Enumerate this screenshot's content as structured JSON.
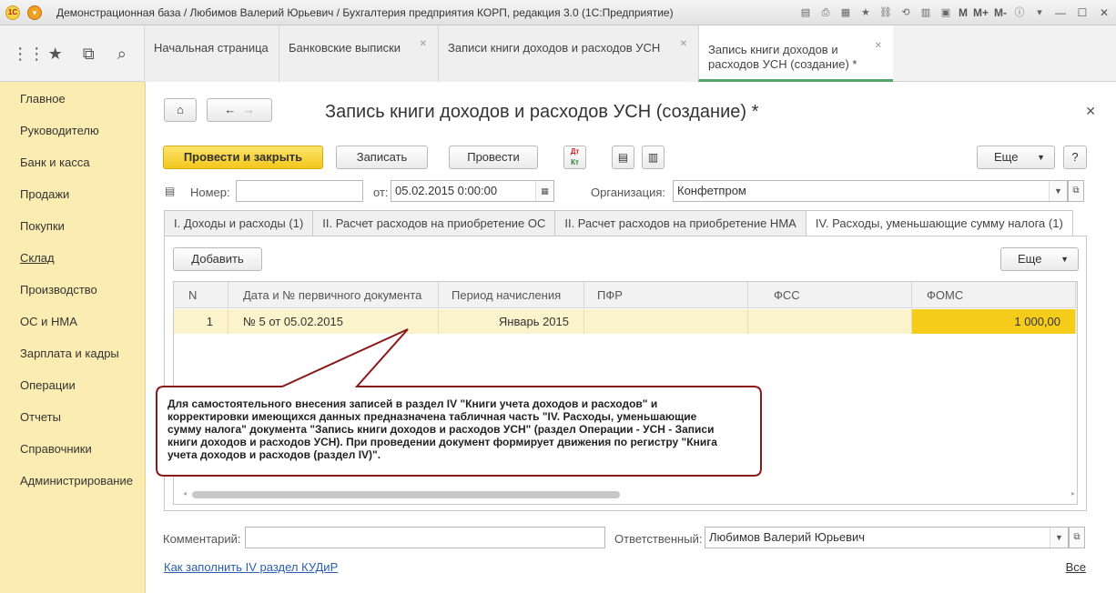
{
  "window": {
    "title": "Демонстрационная база / Любимов Валерий Юрьевич / Бухгалтерия предприятия КОРП, редакция 3.0  (1С:Предприятие)",
    "tools": [
      "M",
      "M+",
      "M-"
    ]
  },
  "tabs": [
    {
      "label": "Начальная страница"
    },
    {
      "label": "Банковские выписки"
    },
    {
      "label": "Записи книги доходов и расходов УСН"
    },
    {
      "label_line1": "Запись книги доходов и",
      "label_line2": "расходов УСН (создание) *"
    }
  ],
  "sidebar": {
    "items": [
      "Главное",
      "Руководителю",
      "Банк и касса",
      "Продажи",
      "Покупки",
      "Склад",
      "Производство",
      "ОС и НМА",
      "Зарплата и кадры",
      "Операции",
      "Отчеты",
      "Справочники",
      "Администрирование"
    ]
  },
  "form": {
    "title": "Запись книги доходов и расходов УСН (создание) *",
    "toolbar": {
      "post_close": "Провести и закрыть",
      "save": "Записать",
      "post": "Провести",
      "more": "Еще",
      "help": "?"
    },
    "number_label": "Номер:",
    "number_value": "",
    "date_label": "от:",
    "date_value": "05.02.2015  0:00:00",
    "org_label": "Организация:",
    "org_value": "Конфетпром",
    "inner_tabs": [
      "I. Доходы и расходы (1)",
      "II. Расчет расходов на приобретение ОС",
      "II. Расчет расходов на приобретение НМА",
      "IV. Расходы, уменьшающие сумму налога (1)"
    ],
    "add_button": "Добавить",
    "panel_more": "Еще",
    "table": {
      "columns": [
        "N",
        "Дата и № первичного документа",
        "Период начисления",
        "ПФР",
        "ФСС",
        "ФОМС"
      ],
      "rows": [
        {
          "n": "1",
          "doc": "№ 5 от 05.02.2015",
          "period": "Январь 2015",
          "pfr": "",
          "fss": "",
          "foms": "1 000,00"
        }
      ]
    },
    "callout": "Для самостоятельного внесения записей в раздел IV \"Книги учета доходов и расходов\" и корректировки имеющихся данных предназначена табличная часть \"IV. Расходы, уменьшающие сумму налога\" документа \"Запись книги доходов и расходов УСН\" (раздел Операции - УСН - Записи книги доходов и расходов УСН). При проведении документ формирует движения по регистру \"Книга учета доходов и расходов (раздел IV)\".",
    "comment_label": "Комментарий:",
    "comment_value": "",
    "responsible_label": "Ответственный:",
    "responsible_value": "Любимов Валерий Юрьевич",
    "help_link": "Как заполнить IV раздел КУДиР",
    "all_link": "Все"
  }
}
